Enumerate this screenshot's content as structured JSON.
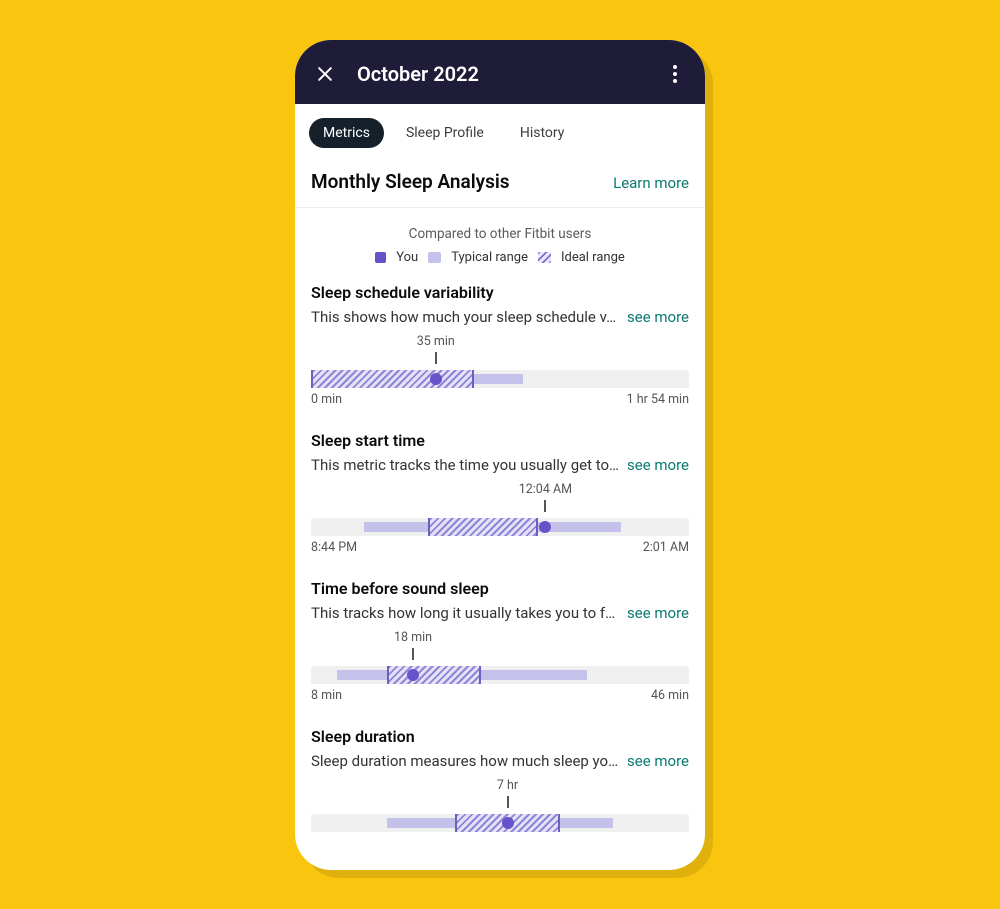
{
  "header": {
    "title": "October 2022"
  },
  "tabs": [
    "Metrics",
    "Sleep Profile",
    "History"
  ],
  "section": {
    "title": "Monthly Sleep Analysis",
    "learn_more": "Learn more"
  },
  "legend": {
    "compare": "Compared to other Fitbit users",
    "you": "You",
    "typical": "Typical range",
    "ideal": "Ideal range"
  },
  "see_more": "see more",
  "chart_data": [
    {
      "title": "Sleep schedule variability",
      "desc": "This shows how much your sleep schedule v…",
      "you_label": "35 min",
      "axis_min": "0 min",
      "axis_max": "1 hr 54 min",
      "you_pct": 33,
      "typical": [
        0,
        56
      ],
      "ideal": [
        0,
        43
      ]
    },
    {
      "title": "Sleep start time",
      "desc": "This metric tracks the time you usually get to…",
      "you_label": "12:04 AM",
      "axis_min": "8:44 PM",
      "axis_max": "2:01 AM",
      "you_pct": 62,
      "typical": [
        14,
        82
      ],
      "ideal": [
        31,
        60
      ]
    },
    {
      "title": "Time before sound sleep",
      "desc": "This tracks how long it usually takes you to f…",
      "you_label": "18 min",
      "axis_min": "8 min",
      "axis_max": "46 min",
      "you_pct": 27,
      "typical": [
        7,
        73
      ],
      "ideal": [
        20,
        45
      ]
    },
    {
      "title": "Sleep duration",
      "desc": "Sleep duration measures how much sleep yo…",
      "you_label": "7 hr",
      "axis_min": "",
      "axis_max": "",
      "you_pct": 52,
      "typical": [
        20,
        80
      ],
      "ideal": [
        38,
        66
      ],
      "truncated": true
    }
  ]
}
